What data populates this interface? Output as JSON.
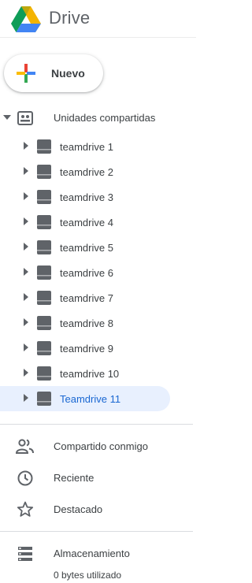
{
  "app": {
    "title": "Drive"
  },
  "new_button": {
    "label": "Nuevo"
  },
  "shared_drives": {
    "label": "Unidades compartidas",
    "items": [
      {
        "label": "teamdrive 1"
      },
      {
        "label": "teamdrive 2"
      },
      {
        "label": "teamdrive 3"
      },
      {
        "label": "teamdrive 4"
      },
      {
        "label": "teamdrive 5"
      },
      {
        "label": "teamdrive 6"
      },
      {
        "label": "teamdrive 7"
      },
      {
        "label": "teamdrive 8"
      },
      {
        "label": "teamdrive 9"
      },
      {
        "label": "teamdrive 10"
      },
      {
        "label": "Teamdrive 11",
        "selected": true
      }
    ]
  },
  "nav": {
    "shared": "Compartido conmigo",
    "recent": "Reciente",
    "starred": "Destacado"
  },
  "storage": {
    "label": "Almacenamiento",
    "used": "0 bytes utilizado"
  },
  "colors": {
    "selected_bg": "#e8f0fe",
    "selected_text": "#1967d2",
    "icon_gray": "#5f6368",
    "drive_green": "#0F9D58",
    "drive_yellow": "#F4B400",
    "drive_blue": "#4285F4",
    "drive_red": "#DB4437"
  },
  "icons": {
    "logo": "google-drive-logo",
    "new": "plus-icon",
    "shared_drives": "shared-drives-icon",
    "drive": "shared-drive-icon",
    "shared_with_me": "people-icon",
    "recent": "clock-icon",
    "starred": "star-icon",
    "storage": "storage-icon"
  }
}
